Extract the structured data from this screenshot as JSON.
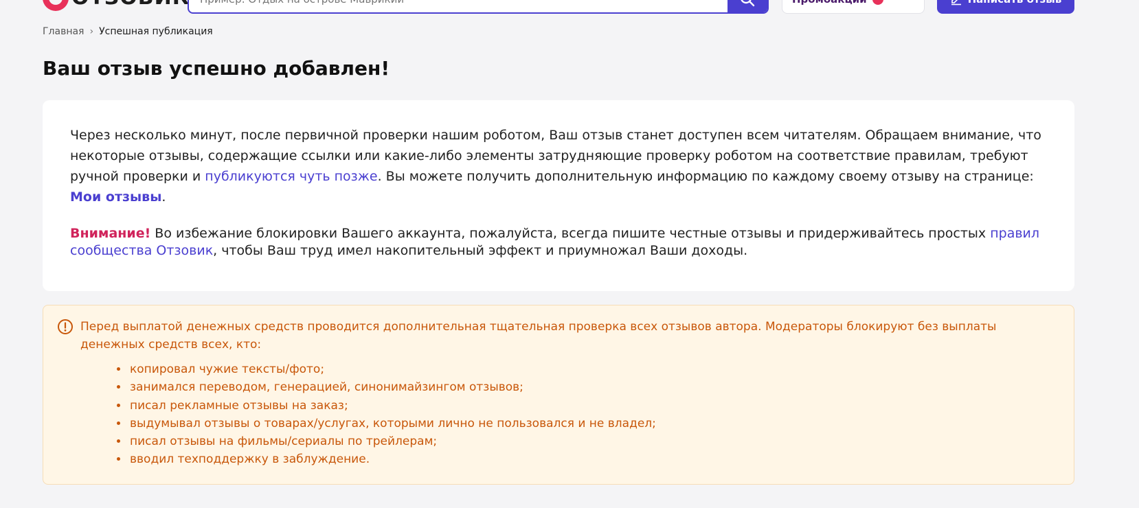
{
  "header": {
    "logo_text": "ОТЗОВИК",
    "search_placeholder": "Пример: Отдых на острове Маврикий",
    "promo_label": "Промоакции",
    "write_label": "Написать отзыв"
  },
  "breadcrumb": {
    "home": "Главная",
    "separator": "›",
    "current": "Успешная публикация"
  },
  "page_title": "Ваш отзыв успешно добавлен!",
  "info": {
    "p1_text_1": "Через несколько минут, после первичной проверки нашим роботом, Ваш отзыв станет доступен всем читателям. Обращаем внимание, что некоторые отзывы, содержащие ссылки или какие-либо элементы затрудняющие проверку роботом на соответствие правилам, требуют ручной проверки и ",
    "p1_link": "публикуются чуть позже",
    "p1_text_2": ". Вы можете получить дополнительную информацию по каждому своему отзыву на странице: ",
    "p1_link_2": "Мои отзывы",
    "p1_text_3": ".",
    "attention_label": "Внимание!",
    "p2_text_1": " Во избежание блокировки Вашего аккаунта, пожалуйста, всегда пишите честные отзывы и придерживайтесь простых ",
    "p2_link": "правил сообщества Отзовик",
    "p2_text_2": ", чтобы Ваш труд имел накопительный эффект и приумножал Ваши доходы."
  },
  "warning": {
    "icon": "exclamation-circle-icon",
    "intro": "Перед выплатой денежных средств проводится дополнительная тщательная проверка всех отзывов автора. Модераторы блокируют без выплаты денежных средств всех, кто:",
    "items": [
      "копировал чужие тексты/фото;",
      "занимался переводом, генерацией, синонимайзингом отзывов;",
      "писал рекламные отзывы на заказ;",
      "выдумывал отзывы о товарах/услугах, которыми лично не пользовался и не владел;",
      "писал отзывы на фильмы/сериалы по трейлерам;",
      "вводил техподдержку в заблуждение."
    ]
  },
  "colors": {
    "accent": "#4a3fd0",
    "brand": "#e8315a",
    "attention": "#d0235b",
    "warning_text": "#c8570a",
    "warning_bg": "#fff6e6"
  }
}
